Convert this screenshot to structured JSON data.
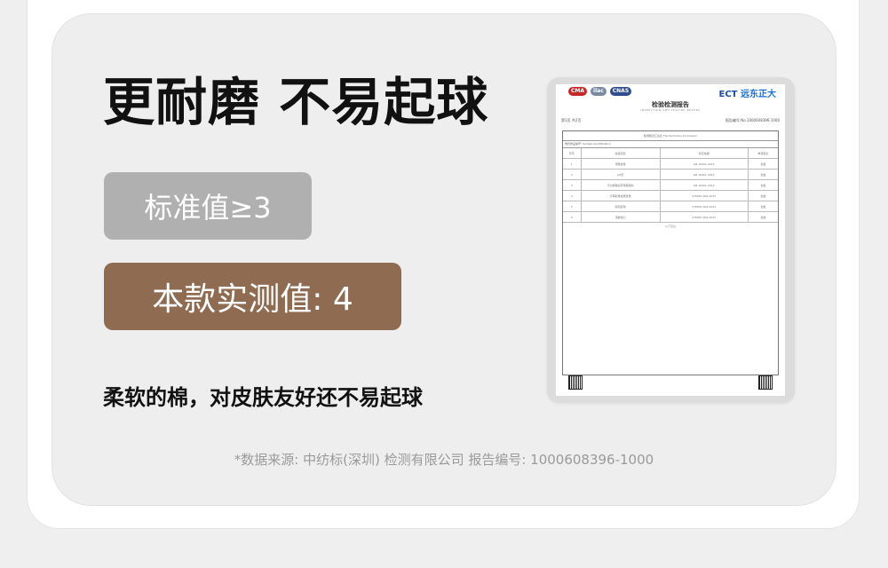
{
  "headline": "更耐磨 不易起球",
  "standard_label": "标准值≥3",
  "measured_label": "本款实测值: 4",
  "subtitle": "柔软的棉，对皮肤友好还不易起球",
  "source_note": "*数据来源: 中纺标(深圳) 检测有限公司 报告编号: 1000608396-1000",
  "colors": {
    "standard_pill": "#b0b0b0",
    "measured_pill": "#8f6b51",
    "panel": "#eeeeee"
  },
  "report": {
    "logos": [
      "CMA",
      "ilac",
      "CNAS"
    ],
    "brand_en": "ECT",
    "brand_cn": "远东正大",
    "title": "检验检测报告",
    "subtitle": "INSPECTION AND TESTING REPORT",
    "page_label": "第1页 共2页",
    "report_no": "报告编号:No.1000608396-1000",
    "table_heading": "检测结论汇总表",
    "table_heading_en": "The Summary Conclusion",
    "table_note": "委托样品编号: Sample Identification",
    "columns": [
      "序号",
      "检验项目",
      "判定依据",
      "单项结论"
    ],
    "rows": [
      [
        "1",
        "甲醛含量",
        "GB 18401-2010",
        "合格"
      ],
      [
        "2",
        "pH值",
        "GB 18401-2010",
        "合格"
      ],
      [
        "3",
        "可分解致癌芳香胺染料",
        "GB 18401-2010",
        "合格"
      ],
      [
        "4",
        "可萃取重金属含量",
        "Q/FZ0D 006-2022",
        "合格"
      ],
      [
        "5",
        "起毛起球",
        "Q/FZ0D 006-2022",
        "合格"
      ],
      [
        "6",
        "顶破强力",
        "Q/FZ0D 006-2022",
        "合格"
      ]
    ],
    "end_note": "以下空白"
  }
}
